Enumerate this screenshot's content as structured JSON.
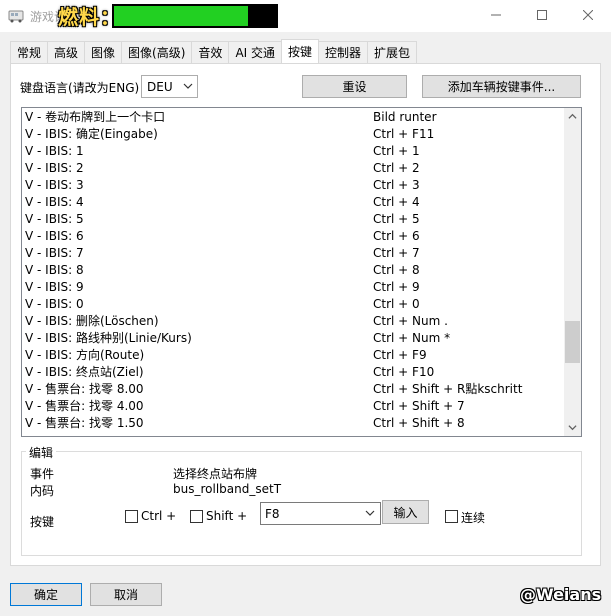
{
  "window": {
    "title": "游戏设",
    "fuel_label": "燃料：",
    "fuel_level": 0.83,
    "fuel_color": "#22d022"
  },
  "tabs": [
    {
      "label": "常规"
    },
    {
      "label": "高级"
    },
    {
      "label": "图像"
    },
    {
      "label": "图像(高级)"
    },
    {
      "label": "音效"
    },
    {
      "label": "AI 交通"
    },
    {
      "label": "按键",
      "active": true
    },
    {
      "label": "控制器"
    },
    {
      "label": "扩展包"
    }
  ],
  "keyboard": {
    "lang_label": "键盘语言(请改为ENG)",
    "lang_value": "DEU",
    "reset_label": "重设",
    "add_event_label": "添加车辆按键事件..."
  },
  "bindings": [
    {
      "event": "V - 卷动布牌到上一个卡口",
      "key": "Bild runter"
    },
    {
      "event": "V - IBIS: 确定(Eingabe)",
      "key": "Ctrl + F11"
    },
    {
      "event": "V - IBIS: 1",
      "key": "Ctrl + 1"
    },
    {
      "event": "V - IBIS: 2",
      "key": "Ctrl + 2"
    },
    {
      "event": "V - IBIS: 3",
      "key": "Ctrl + 3"
    },
    {
      "event": "V - IBIS: 4",
      "key": "Ctrl + 4"
    },
    {
      "event": "V - IBIS: 5",
      "key": "Ctrl + 5"
    },
    {
      "event": "V - IBIS: 6",
      "key": "Ctrl + 6"
    },
    {
      "event": "V - IBIS: 7",
      "key": "Ctrl + 7"
    },
    {
      "event": "V - IBIS: 8",
      "key": "Ctrl + 8"
    },
    {
      "event": "V - IBIS: 9",
      "key": "Ctrl + 9"
    },
    {
      "event": "V - IBIS: 0",
      "key": "Ctrl + 0"
    },
    {
      "event": "V - IBIS: 删除(Löschen)",
      "key": "Ctrl + Num ."
    },
    {
      "event": "V - IBIS: 路线种别(Linie/Kurs)",
      "key": "Ctrl + Num *"
    },
    {
      "event": "V - IBIS: 方向(Route)",
      "key": "Ctrl + F9"
    },
    {
      "event": "V - IBIS: 终点站(Ziel)",
      "key": "Ctrl + F10"
    },
    {
      "event": "V - 售票台: 找零 8.00",
      "key": "Ctrl + Shift + R點kschritt"
    },
    {
      "event": "V - 售票台: 找零 4.00",
      "key": "Ctrl + Shift + 7"
    },
    {
      "event": "V - 售票台: 找零 1.50",
      "key": "Ctrl + Shift + 8"
    }
  ],
  "edit": {
    "group_title": "编辑",
    "event_label": "事件",
    "event_value": "选择终点站布牌",
    "code_label": "内码",
    "code_value": "bus_rollband_setT",
    "key_label": "按键",
    "ctrl_label": "Ctrl +",
    "shift_label": "Shift +",
    "key_value": "F8",
    "input_label": "输入",
    "continuous_label": "连续"
  },
  "footer": {
    "ok_label": "确定",
    "cancel_label": "取消",
    "watermark": "@Weians"
  }
}
